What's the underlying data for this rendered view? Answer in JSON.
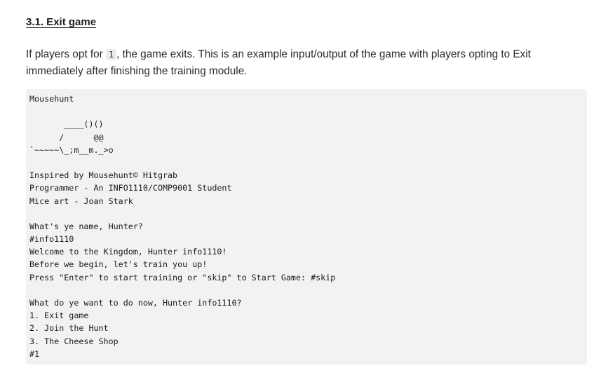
{
  "heading": "3.1. Exit game",
  "intro": {
    "before": "If players opt for ",
    "code": "1",
    "after": ", the game exits. This is an example input/output of the game with players opting to Exit immediately after finishing the training module."
  },
  "code_lines": [
    "Mousehunt",
    "",
    "       ____()()",
    "      /      @@",
    "`~~~~~\\_;m__m._>o",
    "",
    "Inspired by Mousehunt© Hitgrab",
    "Programmer - An INFO1110/COMP9001 Student",
    "Mice art - Joan Stark",
    "",
    "What's ye name, Hunter?",
    "#info1110",
    "Welcome to the Kingdom, Hunter info1110!",
    "Before we begin, let's train you up!",
    "Press \"Enter\" to start training or \"skip\" to Start Game: #skip",
    "",
    "What do ye want to do now, Hunter info1110?",
    "1. Exit game",
    "2. Join the Hunt",
    "3. The Cheese Shop",
    "#1"
  ]
}
